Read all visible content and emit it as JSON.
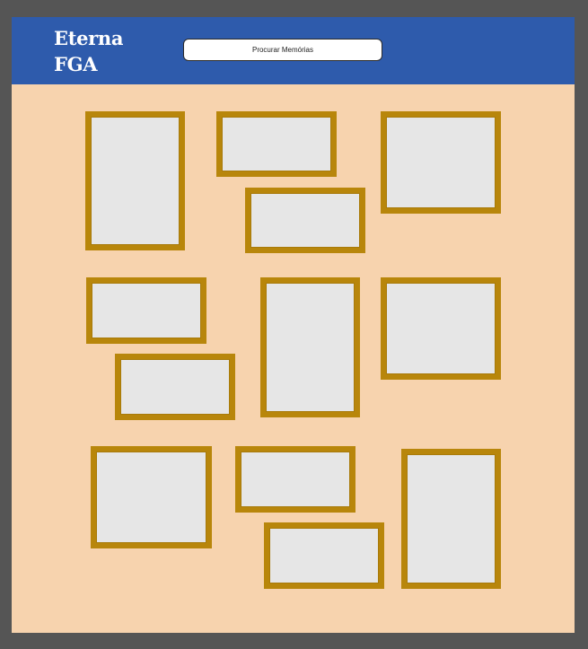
{
  "brand": {
    "line1": "Eterna",
    "line2": "FGA"
  },
  "search": {
    "label": "Procurar Memórias"
  },
  "colors": {
    "page_background": "#555555",
    "canvas_background": "#f7d3ae",
    "header_background": "#2e5bac",
    "frame_border": "#b8860b",
    "frame_fill": "#e6e6e6"
  },
  "memories": [
    {
      "id": 1
    },
    {
      "id": 2
    },
    {
      "id": 3
    },
    {
      "id": 4
    },
    {
      "id": 5
    },
    {
      "id": 6
    },
    {
      "id": 7
    },
    {
      "id": 8
    },
    {
      "id": 9
    },
    {
      "id": 10
    },
    {
      "id": 11
    },
    {
      "id": 12
    }
  ]
}
